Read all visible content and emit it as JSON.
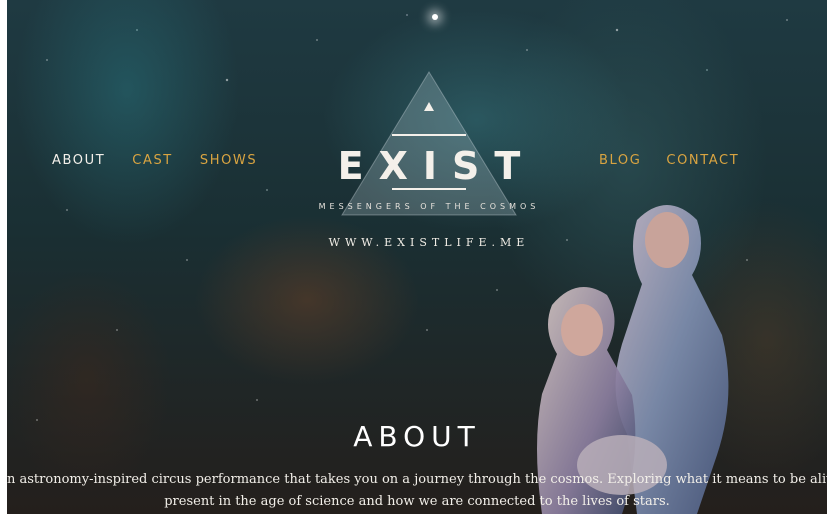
{
  "colors": {
    "nav_active": "#f4f0ea",
    "nav_accent": "#d9a441",
    "text_light": "#ffffff"
  },
  "nav": {
    "left": [
      {
        "label": "ABOUT",
        "active": true
      },
      {
        "label": "CAST",
        "active": false
      },
      {
        "label": "SHOWS",
        "active": false
      }
    ],
    "right": [
      {
        "label": "BLOG",
        "active": false
      },
      {
        "label": "CONTACT",
        "active": false
      }
    ]
  },
  "logo": {
    "word": "EXIST",
    "tagline": "MESSENGERS OF THE COSMOS",
    "url": "WWW.EXISTLIFE.ME",
    "icon": "triangle-logo-icon"
  },
  "about": {
    "heading": "ABOUT",
    "line1": "n astronomy-inspired circus performance that takes you on a journey through the cosmos. Exploring what it means to be alive",
    "line2": "present in the age of science and how we are connected to the lives of stars."
  }
}
